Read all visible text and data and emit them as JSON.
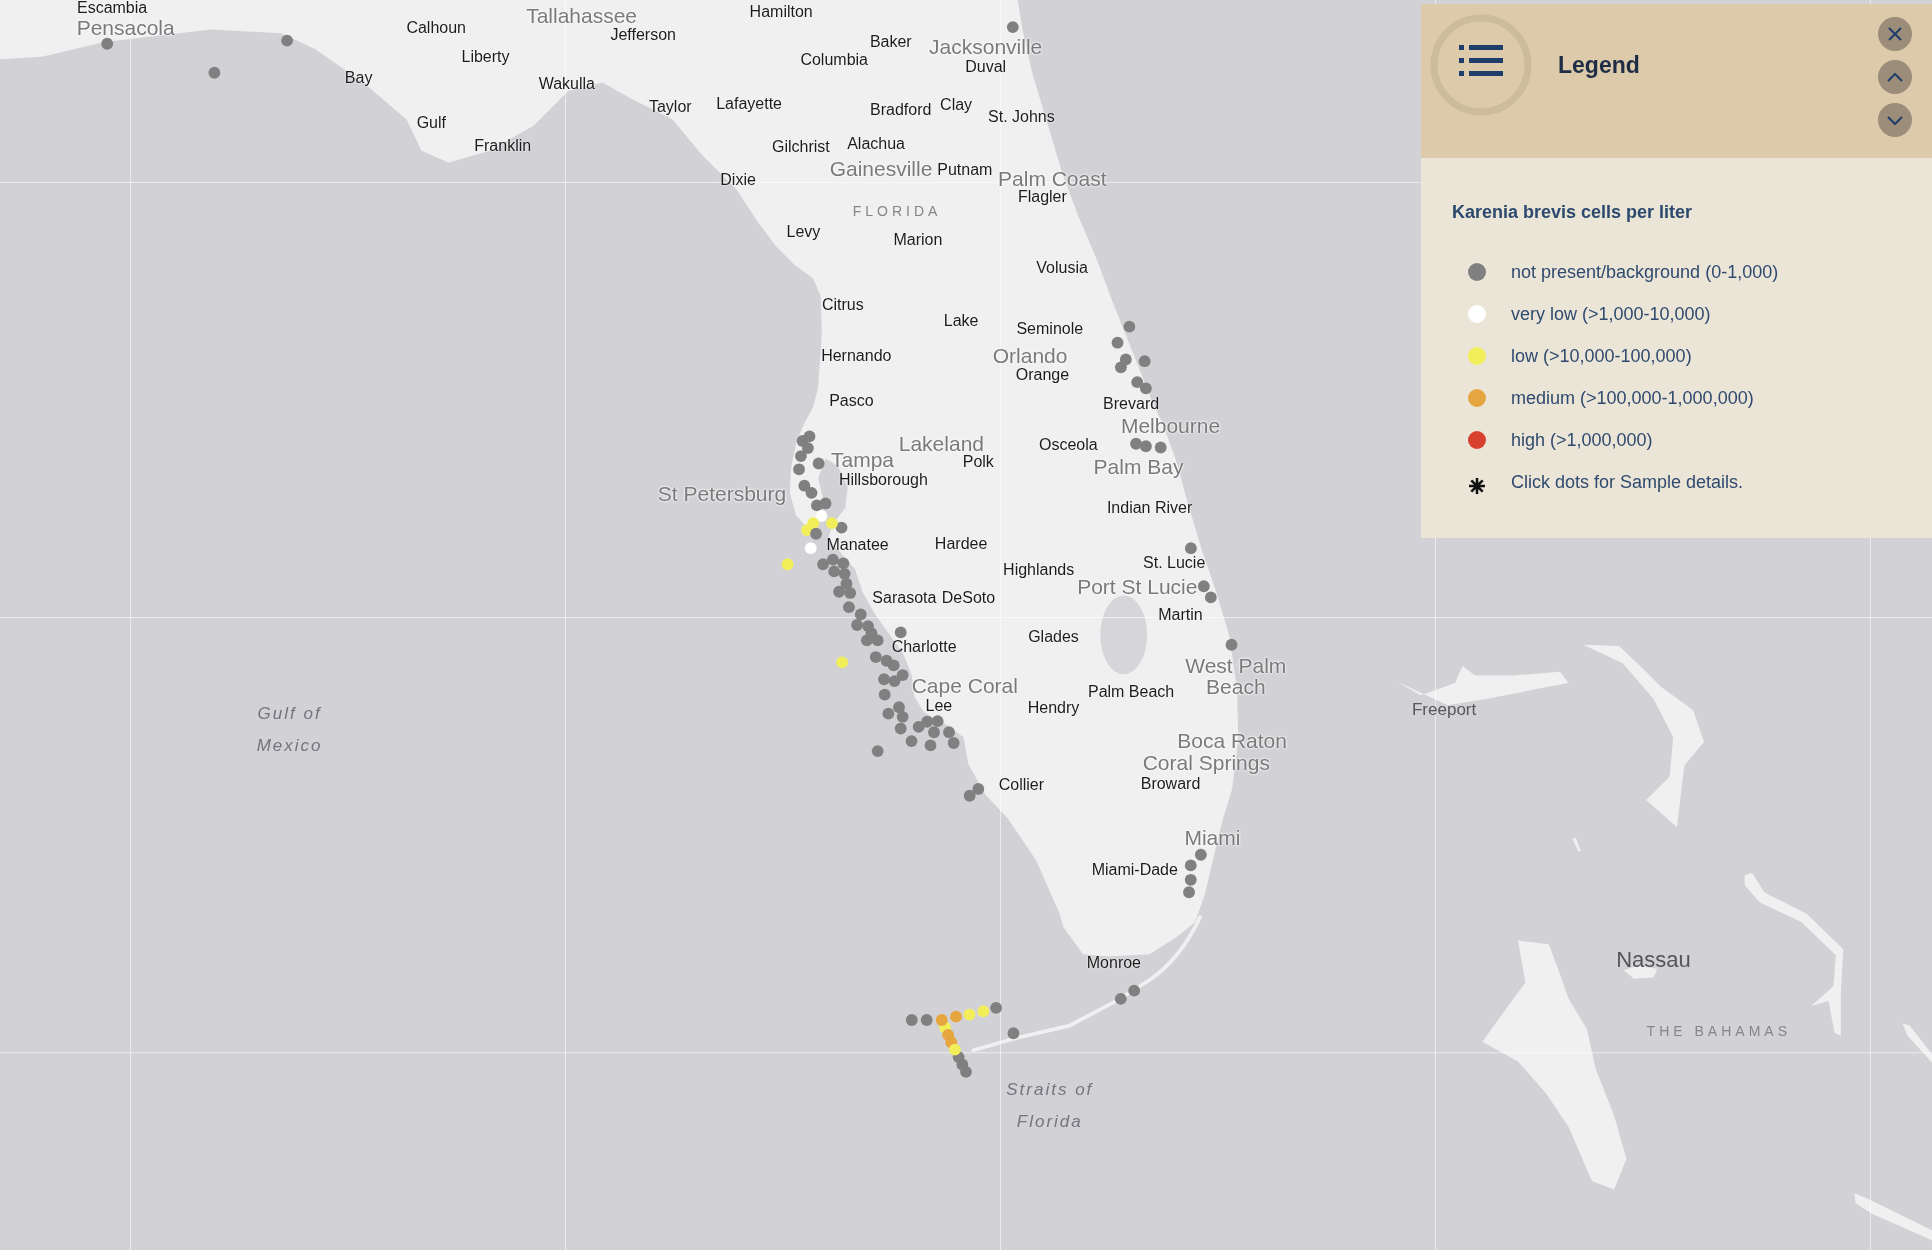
{
  "map": {
    "labels": [
      {
        "text": "Escambia",
        "kind": "county"
      },
      {
        "text": "Pensacola",
        "kind": "city"
      },
      {
        "text": "Calhoun",
        "kind": "county"
      },
      {
        "text": "Tallahassee",
        "kind": "city"
      },
      {
        "text": "Hamilton",
        "kind": "county"
      },
      {
        "text": "Jefferson",
        "kind": "county"
      },
      {
        "text": "Baker",
        "kind": "county"
      },
      {
        "text": "Jacksonville",
        "kind": "city"
      },
      {
        "text": "Liberty",
        "kind": "county"
      },
      {
        "text": "Columbia",
        "kind": "county"
      },
      {
        "text": "Duval",
        "kind": "county"
      },
      {
        "text": "Bay",
        "kind": "county"
      },
      {
        "text": "Wakulla",
        "kind": "county"
      },
      {
        "text": "Taylor",
        "kind": "county"
      },
      {
        "text": "Lafayette",
        "kind": "county"
      },
      {
        "text": "Bradford",
        "kind": "county"
      },
      {
        "text": "Clay",
        "kind": "county"
      },
      {
        "text": "St. Johns",
        "kind": "county"
      },
      {
        "text": "Gulf",
        "kind": "county"
      },
      {
        "text": "Franklin",
        "kind": "county"
      },
      {
        "text": "Gilchrist",
        "kind": "county"
      },
      {
        "text": "Alachua",
        "kind": "county"
      },
      {
        "text": "Dixie",
        "kind": "county"
      },
      {
        "text": "Gainesville",
        "kind": "city"
      },
      {
        "text": "Putnam",
        "kind": "county"
      },
      {
        "text": "Palm Coast",
        "kind": "city"
      },
      {
        "text": "Flagler",
        "kind": "county"
      },
      {
        "text": "FLORIDA",
        "kind": "region"
      },
      {
        "text": "Levy",
        "kind": "county"
      },
      {
        "text": "Marion",
        "kind": "county"
      },
      {
        "text": "Volusia",
        "kind": "county"
      },
      {
        "text": "Citrus",
        "kind": "county"
      },
      {
        "text": "Lake",
        "kind": "county"
      },
      {
        "text": "Seminole",
        "kind": "county"
      },
      {
        "text": "Hernando",
        "kind": "county"
      },
      {
        "text": "Orlando",
        "kind": "city"
      },
      {
        "text": "Orange",
        "kind": "county"
      },
      {
        "text": "Pasco",
        "kind": "county"
      },
      {
        "text": "Brevard",
        "kind": "county"
      },
      {
        "text": "Melbourne",
        "kind": "city"
      },
      {
        "text": "Lakeland",
        "kind": "city"
      },
      {
        "text": "Osceola",
        "kind": "county"
      },
      {
        "text": "Tampa",
        "kind": "city"
      },
      {
        "text": "Polk",
        "kind": "county"
      },
      {
        "text": "Palm Bay",
        "kind": "city"
      },
      {
        "text": "Hillsborough",
        "kind": "county"
      },
      {
        "text": "St Petersburg",
        "kind": "city"
      },
      {
        "text": "Indian River",
        "kind": "county"
      },
      {
        "text": "Hardee",
        "kind": "county"
      },
      {
        "text": "Manatee",
        "kind": "county"
      },
      {
        "text": "St. Lucie",
        "kind": "county"
      },
      {
        "text": "Highlands",
        "kind": "county"
      },
      {
        "text": "Port St Lucie",
        "kind": "city"
      },
      {
        "text": "Sarasota",
        "kind": "county"
      },
      {
        "text": "DeSoto",
        "kind": "county"
      },
      {
        "text": "Martin",
        "kind": "county"
      },
      {
        "text": "Glades",
        "kind": "county"
      },
      {
        "text": "Charlotte",
        "kind": "county"
      },
      {
        "text": "Gulf of\nMexico",
        "kind": "water"
      },
      {
        "text": "Cape Coral",
        "kind": "city"
      },
      {
        "text": "Palm Beach",
        "kind": "county"
      },
      {
        "text": "West Palm\nBeach",
        "kind": "city"
      },
      {
        "text": "Lee",
        "kind": "county"
      },
      {
        "text": "Hendry",
        "kind": "county"
      },
      {
        "text": "Freeport",
        "kind": "town"
      },
      {
        "text": "Boca Raton",
        "kind": "city"
      },
      {
        "text": "Coral Springs",
        "kind": "city"
      },
      {
        "text": "Broward",
        "kind": "county"
      },
      {
        "text": "Collier",
        "kind": "county"
      },
      {
        "text": "Miami",
        "kind": "city"
      },
      {
        "text": "Miami-Dade",
        "kind": "county"
      },
      {
        "text": "Monroe",
        "kind": "county"
      },
      {
        "text": "Nassau",
        "kind": "capital"
      },
      {
        "text": "THE BAHAMAS",
        "kind": "region"
      },
      {
        "text": "Straits of\nFlorida",
        "kind": "water"
      }
    ],
    "samples": [
      {
        "color": "#808080"
      },
      {
        "color": "#808080"
      },
      {
        "color": "#808080"
      },
      {
        "color": "#808080"
      },
      {
        "color": "#808080"
      },
      {
        "color": "#808080"
      },
      {
        "color": "#808080"
      },
      {
        "color": "#808080"
      },
      {
        "color": "#808080"
      },
      {
        "color": "#808080"
      },
      {
        "color": "#808080"
      },
      {
        "color": "#808080"
      },
      {
        "color": "#808080"
      },
      {
        "color": "#808080"
      },
      {
        "color": "#808080"
      },
      {
        "color": "#808080"
      },
      {
        "color": "#808080"
      },
      {
        "color": "#808080"
      },
      {
        "color": "#808080"
      },
      {
        "color": "#808080"
      },
      {
        "color": "#808080"
      },
      {
        "color": "#808080"
      },
      {
        "color": "#808080"
      },
      {
        "color": "#808080"
      },
      {
        "color": "#808080"
      },
      {
        "color": "#808080"
      },
      {
        "color": "#808080"
      },
      {
        "color": "#808080"
      },
      {
        "color": "#808080"
      },
      {
        "color": "#808080"
      },
      {
        "color": "#ffffff"
      },
      {
        "color": "#808080"
      },
      {
        "color": "#f2ee5a"
      },
      {
        "color": "#f2ee5a"
      },
      {
        "color": "#f2ee5a"
      },
      {
        "color": "#808080"
      },
      {
        "color": "#ffffff"
      },
      {
        "color": "#f2ee5a"
      },
      {
        "color": "#808080"
      },
      {
        "color": "#808080"
      },
      {
        "color": "#808080"
      },
      {
        "color": "#808080"
      },
      {
        "color": "#808080"
      },
      {
        "color": "#808080"
      },
      {
        "color": "#808080"
      },
      {
        "color": "#808080"
      },
      {
        "color": "#808080"
      },
      {
        "color": "#808080"
      },
      {
        "color": "#808080"
      },
      {
        "color": "#808080"
      },
      {
        "color": "#808080"
      },
      {
        "color": "#808080"
      },
      {
        "color": "#808080"
      },
      {
        "color": "#808080"
      },
      {
        "color": "#f2ee5a"
      },
      {
        "color": "#808080"
      },
      {
        "color": "#808080"
      },
      {
        "color": "#808080"
      },
      {
        "color": "#808080"
      },
      {
        "color": "#808080"
      },
      {
        "color": "#808080"
      },
      {
        "color": "#808080"
      },
      {
        "color": "#808080"
      },
      {
        "color": "#808080"
      },
      {
        "color": "#808080"
      },
      {
        "color": "#808080"
      },
      {
        "color": "#808080"
      },
      {
        "color": "#808080"
      },
      {
        "color": "#808080"
      },
      {
        "color": "#808080"
      },
      {
        "color": "#808080"
      },
      {
        "color": "#808080"
      },
      {
        "color": "#808080"
      },
      {
        "color": "#808080"
      },
      {
        "color": "#808080"
      },
      {
        "color": "#808080"
      },
      {
        "color": "#808080"
      },
      {
        "color": "#808080"
      },
      {
        "color": "#808080"
      },
      {
        "color": "#808080"
      },
      {
        "color": "#808080"
      },
      {
        "color": "#808080"
      },
      {
        "color": "#808080"
      },
      {
        "color": "#f2ee5a"
      },
      {
        "color": "#f2ee5a"
      },
      {
        "color": "#e6a53f"
      },
      {
        "color": "#808080"
      },
      {
        "color": "#808080"
      },
      {
        "color": "#f2ee5a"
      },
      {
        "color": "#e6a53f"
      },
      {
        "color": "#e6a53f"
      },
      {
        "color": "#e6a53f"
      },
      {
        "color": "#808080"
      },
      {
        "color": "#808080"
      },
      {
        "color": "#808080"
      },
      {
        "color": "#f2ee5a"
      }
    ]
  },
  "legend": {
    "title": "Legend",
    "subtitle": "Karenia brevis cells per liter",
    "items": [
      {
        "label": "not present/background (0-1,000)",
        "color": "#808080"
      },
      {
        "label": "very low (>1,000-10,000)",
        "color": "#ffffff"
      },
      {
        "label": "low (>10,000-100,000)",
        "color": "#f2ee5a"
      },
      {
        "label": "medium (>100,000-1,000,000)",
        "color": "#e6a53f"
      },
      {
        "label": "high (>1,000,000)",
        "color": "#d8402e"
      }
    ],
    "note": "Click dots for Sample details."
  }
}
